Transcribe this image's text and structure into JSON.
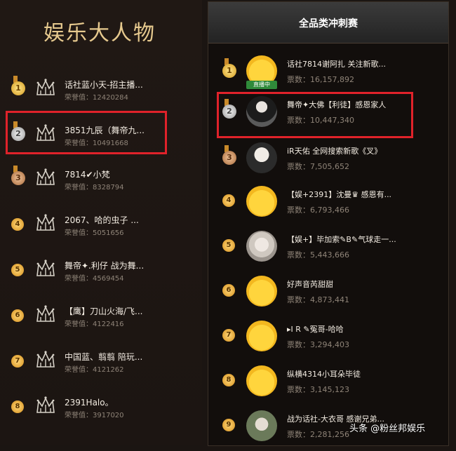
{
  "left_panel": {
    "title": "娱乐大人物",
    "rows": [
      {
        "rank": "1",
        "name": "话社蓝小天-招主播...",
        "score": "荣誉值：12420284"
      },
      {
        "rank": "2",
        "name": "3851九辰（舞帝九...",
        "score": "荣誉值：10491668"
      },
      {
        "rank": "3",
        "name": "7814✔小梵",
        "score": "荣誉值：8328794"
      },
      {
        "rank": "4",
        "name": "2067、哈的虫子 ...",
        "score": "荣誉值：5051656"
      },
      {
        "rank": "5",
        "name": "舞帝✦.利仔 战为舞...",
        "score": "荣誉值：4569454"
      },
      {
        "rank": "6",
        "name": "【鹰】刀山火海/飞...",
        "score": "荣誉值：4122416"
      },
      {
        "rank": "7",
        "name": "中国蓝、翦翦 陪玩...",
        "score": "荣誉值：4121262"
      },
      {
        "rank": "8",
        "name": "2391Halo。",
        "score": "荣誉值：3917020"
      }
    ]
  },
  "right_panel": {
    "title": "全品类冲刺赛",
    "live_label": "直播中",
    "rows": [
      {
        "rank": "1",
        "name": "话社7814谢阿扎 关注新歌...",
        "score": "票数：16,157,892"
      },
      {
        "rank": "2",
        "name": "舞帝✦大佛【利徒】感恩家人",
        "score": "票数：10,447,340"
      },
      {
        "rank": "3",
        "name": "iR天佑 全网搜索新歌《叉》",
        "score": "票数：7,505,652"
      },
      {
        "rank": "4",
        "name": "【娱+2391】沈曼♛ 感恩有...",
        "score": "票数：6,793,466"
      },
      {
        "rank": "5",
        "name": "【娱+】毕加索✎B✎气球走一...",
        "score": "票数：5,443,666"
      },
      {
        "rank": "6",
        "name": "好声音芮甜甜",
        "score": "票数：4,873,441"
      },
      {
        "rank": "7",
        "name": "▸I R ✎冤哥-哈哈",
        "score": "票数：3,294,403"
      },
      {
        "rank": "8",
        "name": "纵横4314小耳朵毕徒",
        "score": "票数：3,145,123"
      },
      {
        "rank": "9",
        "name": "战为话社-大衣哥 感谢兄弟...",
        "score": "票数：2,281,256"
      }
    ]
  },
  "watermark": "头条 @粉丝邦娱乐",
  "colors": {
    "highlight": "#e0222a",
    "gold": "#e6c98e",
    "background": "#1b1512"
  }
}
